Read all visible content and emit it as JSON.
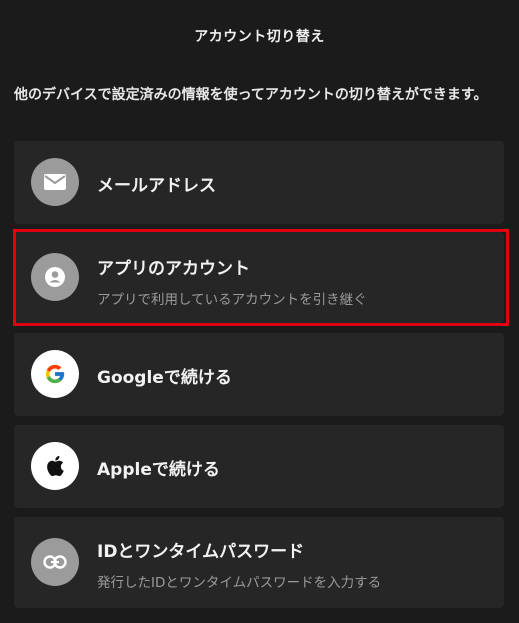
{
  "header": {
    "title": "アカウント切り替え"
  },
  "description": "他のデバイスで設定済みの情報を使ってアカウントの切り替えができます。",
  "options": [
    {
      "title": "メールアドレス",
      "icon": "mail-icon"
    },
    {
      "title": "アプリのアカウント",
      "subtitle": "アプリで利用しているアカウントを引き継ぐ",
      "icon": "user-icon"
    },
    {
      "title": "Googleで続ける",
      "icon": "google-icon"
    },
    {
      "title": "Appleで続ける",
      "icon": "apple-icon"
    },
    {
      "title": "IDとワンタイムパスワード",
      "subtitle": "発行したIDとワンタイムパスワードを入力する",
      "icon": "link-icon"
    }
  ],
  "colors": {
    "background": "#1b1b1b",
    "card": "#262626",
    "highlight": "#e0000f",
    "icon_grey": "#9b9b9b"
  }
}
